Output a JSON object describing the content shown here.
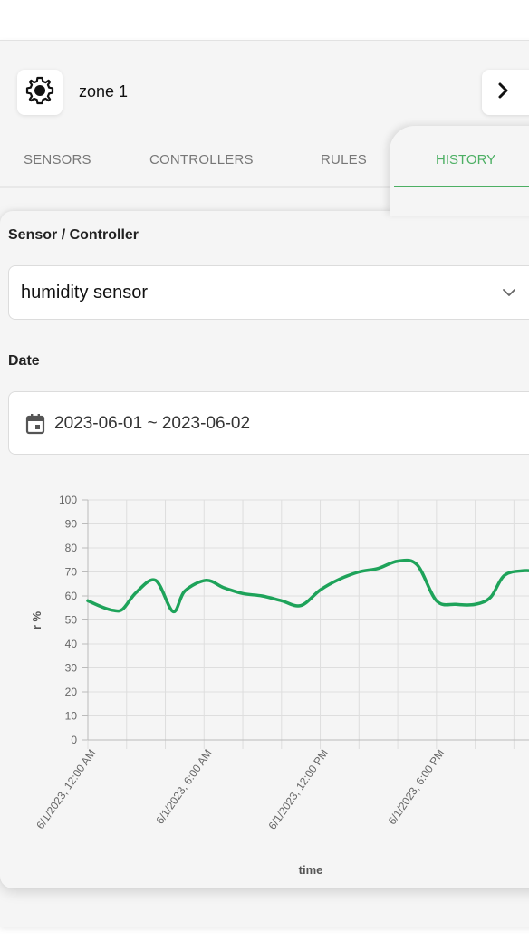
{
  "header": {
    "zone_title": "zone 1",
    "settings_icon": "gear-icon",
    "next_icon": "chevron-right-icon"
  },
  "tabs": [
    {
      "label": "SENSORS",
      "active": false
    },
    {
      "label": "CONTROLLERS",
      "active": false
    },
    {
      "label": "RULES",
      "active": false
    },
    {
      "label": "HISTORY",
      "active": true
    }
  ],
  "form": {
    "sensor_label": "Sensor / Controller",
    "sensor_value": "humidity sensor",
    "date_label": "Date",
    "date_value": "2023-06-01 ~ 2023-06-02"
  },
  "colors": {
    "accent": "#4caf63",
    "series": "#1ea35a"
  },
  "chart_data": {
    "type": "line",
    "xlabel": "time",
    "ylabel": "r %",
    "ylim": [
      0,
      100
    ],
    "yticks": [
      0,
      10,
      20,
      30,
      40,
      50,
      60,
      70,
      80,
      90,
      100
    ],
    "xtick_labels": [
      {
        "hour": 0,
        "label": "6/1/2023, 12:00 AM"
      },
      {
        "hour": 6,
        "label": "6/1/2023, 6:00 AM"
      },
      {
        "hour": 12,
        "label": "6/1/2023, 12:00 PM"
      },
      {
        "hour": 18,
        "label": "6/1/2023, 6:00 PM"
      }
    ],
    "grid": true,
    "series": [
      {
        "x_hours": [
          0,
          0.7,
          1.3,
          1.8,
          2.5,
          3.5,
          4.4,
          5,
          6.1,
          7,
          8,
          9,
          10,
          11,
          12,
          13,
          14,
          15,
          16,
          17,
          18,
          19,
          20,
          20.8,
          21.5,
          22.5,
          23.5
        ],
        "y": [
          58,
          55.5,
          54,
          54.5,
          61.5,
          66.5,
          53.5,
          62,
          66.5,
          63.5,
          61,
          60,
          58,
          56,
          62.5,
          67,
          70,
          71.5,
          74.5,
          73,
          58,
          56.5,
          56.5,
          59.5,
          68.5,
          70.5,
          70
        ]
      }
    ]
  }
}
